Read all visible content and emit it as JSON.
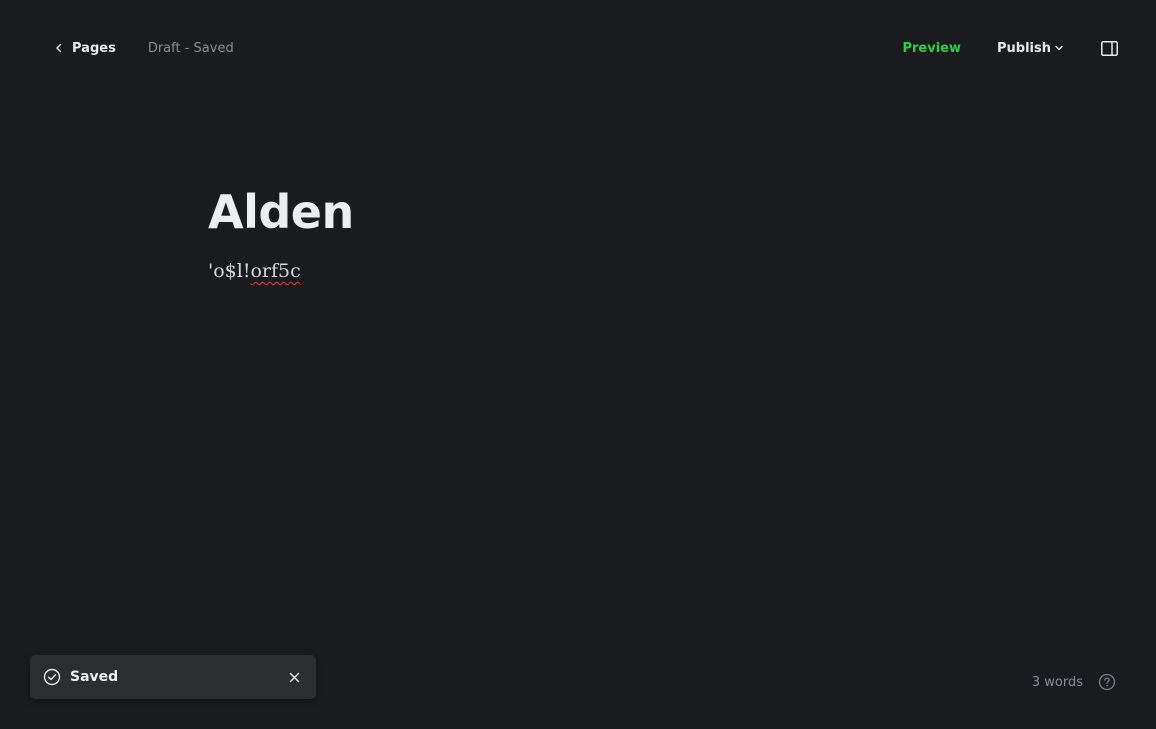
{
  "header": {
    "back_label": "Pages",
    "status": "Draft - Saved",
    "preview_label": "Preview",
    "publish_label": "Publish"
  },
  "editor": {
    "title": "Alden",
    "body_prefix": "'o$l!",
    "body_misspelled": "orf5c"
  },
  "toast": {
    "message": "Saved"
  },
  "footer": {
    "word_count": "3 words"
  },
  "colors": {
    "background": "#191b1e",
    "accent_green": "#30cf43",
    "toast_background": "#2b2d31",
    "spellcheck_underline": "#e2363c"
  },
  "icons": {
    "back": "chevron-left-icon",
    "publish_dropdown": "chevron-down-icon",
    "sidebar": "sidebar-toggle-icon",
    "toast_status": "check-circle-icon",
    "toast_close": "close-icon",
    "help": "help-circle-icon"
  }
}
